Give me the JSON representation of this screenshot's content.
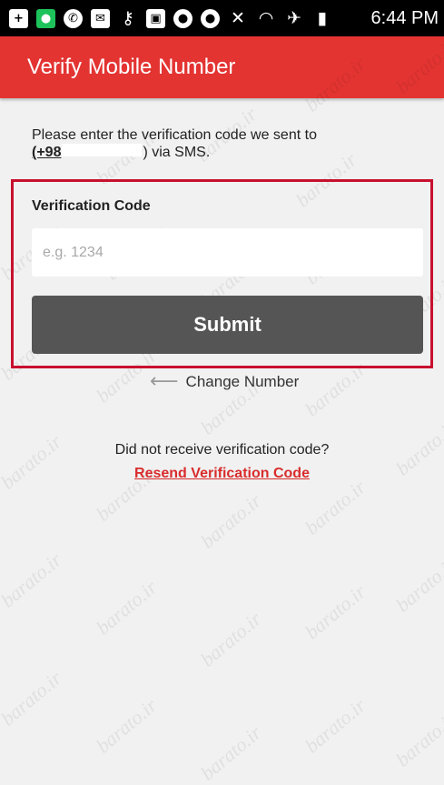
{
  "status_bar": {
    "time": "6:44 PM",
    "icons": [
      "plus-square-icon",
      "green-app-icon",
      "whatsapp-icon",
      "message-icon",
      "key-icon",
      "image-icon",
      "line-app-icon",
      "line-chat-icon",
      "mute-icon",
      "wifi-icon",
      "airplane-icon",
      "battery-icon"
    ]
  },
  "app_bar": {
    "title": "Verify Mobile Number",
    "color": "#e33432"
  },
  "intro": {
    "text": "Please enter the verification code we sent to",
    "phone_prefix": "(+98",
    "phone_suffix": ")",
    "via": "via SMS."
  },
  "form": {
    "label": "Verification Code",
    "placeholder": "e.g. 1234",
    "value": "",
    "submit_label": "Submit"
  },
  "change_number": {
    "label": "Change Number",
    "icon": "left-arrow-icon"
  },
  "resend": {
    "question": "Did not receive verification code?",
    "link_label": "Resend Verification Code",
    "link_color": "#d92c2c"
  },
  "watermark": "barato.ir"
}
